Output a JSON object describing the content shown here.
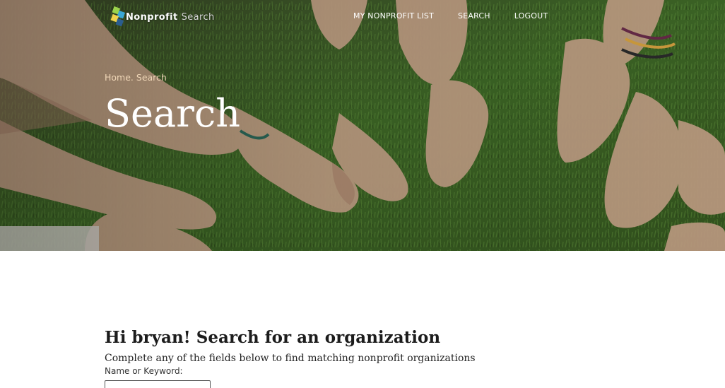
{
  "brand": {
    "name_main": "Nonprofit",
    "name_tail": "Search",
    "accent_colors": [
      "#9bd34c",
      "#3aa7d6",
      "#f0d24a",
      "#2b5d8f"
    ]
  },
  "nav": {
    "items": [
      {
        "label": "MY NONPROFIT LIST"
      },
      {
        "label": "SEARCH"
      },
      {
        "label": "LOGOUT"
      }
    ]
  },
  "hero": {
    "breadcrumb": {
      "home": "Home",
      "separator": ".",
      "current": "Search"
    },
    "title": "Search"
  },
  "main": {
    "greeting": "Hi bryan! Search for an organization",
    "subtitle": "Complete any of the fields below to find matching nonprofit organizations",
    "fields": [
      {
        "label": "Name or Keyword:",
        "value": "",
        "placeholder": ""
      }
    ]
  }
}
